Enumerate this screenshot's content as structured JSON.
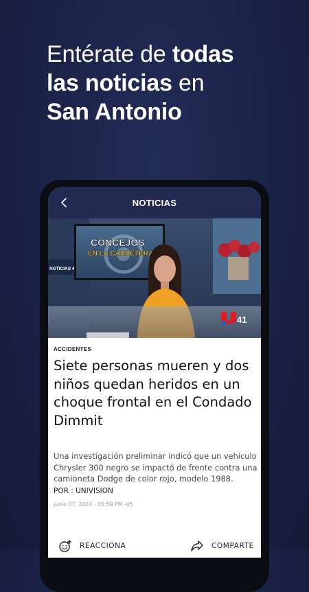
{
  "promo": {
    "line1_normal": "Entérate de ",
    "line1_bold": "todas",
    "line2_bold": "las noticias",
    "line2_normal": " en",
    "line3_bold": "San Antonio"
  },
  "appbar": {
    "title": "NOTICIAS",
    "back_icon": "chevron-left-icon"
  },
  "video": {
    "screen_text_line1": "CONCEJOS",
    "screen_text_line2": "EN LA CARRETERA",
    "wall_text": "NOTICIAS 41",
    "logo_number": "41"
  },
  "article": {
    "category": "ACCIDENTES",
    "title": "Siete personas mueren y dos niños quedan heridos en un choque frontal en el Condado Dimmit",
    "summary": "Una investigación preliminar indicó que un vehículo Chrysler 300 negro se impactó de frente contra una camioneta Dodge de color rojo, modelo 1988.",
    "byline": "POR : UNIVISION",
    "date": "junio 07, 2024 - 05:59 PM -05"
  },
  "actions": {
    "react_label": "REACCIONA",
    "react_icon": "smiley-add-icon",
    "share_label": "COMPARTE",
    "share_icon": "share-arrow-icon"
  },
  "colors": {
    "background": "#1b2247",
    "appbar": "#222a52",
    "univision_red": "#e11b22",
    "univision_blue": "#1b62c9"
  }
}
